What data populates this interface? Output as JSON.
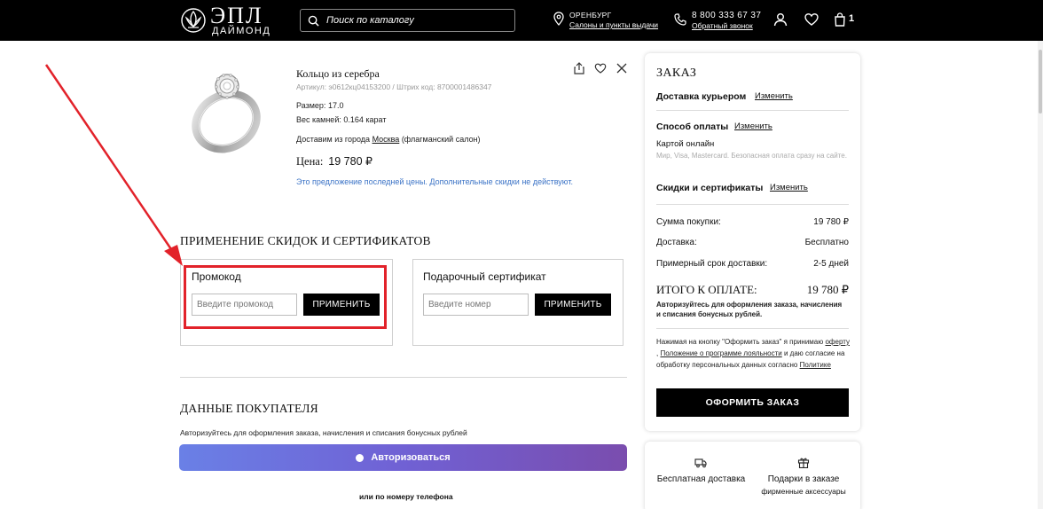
{
  "header": {
    "logo_main": "ЭПЛ",
    "logo_sub": "ДАЙМОНД",
    "search_placeholder": "Поиск по каталогу",
    "city": "ОРЕНБУРГ",
    "city_link": "Салоны и пункты выдачи",
    "phone": "8 800 333 67 37",
    "phone_link": "Обратный звонок",
    "cart_count": "1"
  },
  "product": {
    "title": "Кольцо из серебра",
    "article": "Артикул: э0612кц04153200 / Штрих код: 8700001486347",
    "size_label": "Размер:",
    "size_value": "17.0",
    "stones_label": "Вес камней:",
    "stones_value": "0.164 карат",
    "ship_prefix": "Доставим из города",
    "ship_city": "Москва",
    "ship_suffix": "(флагманский салон)",
    "price_label": "Цена:",
    "price_value": "19 780 ₽",
    "note": "Это предложение последней цены. Дополнительные скидки не действуют."
  },
  "discounts": {
    "title": "ПРИМЕНЕНИЕ СКИДОК И СЕРТИФИКАТОВ",
    "promo_title": "Промокод",
    "promo_placeholder": "Введите промокод",
    "promo_button": "ПРИМЕНИТЬ",
    "gift_title": "Подарочный сертификат",
    "gift_placeholder": "Введите номер",
    "gift_button": "ПРИМЕНИТЬ"
  },
  "buyer": {
    "title": "ДАННЫЕ ПОКУПАТЕЛЯ",
    "auth_note": "Авторизуйтесь для оформления заказа, начисления и списания бонусных рублей",
    "auth_button": "Авторизоваться",
    "or_phone": "или по номеру телефона"
  },
  "order": {
    "title": "ЗАКАЗ",
    "delivery_label": "Доставка курьером",
    "change": "Изменить",
    "payment_label": "Способ оплаты",
    "payment_value": "Картой онлайн",
    "payment_note": "Мир, Visa, Mastercard. Безопасная оплата сразу на сайте.",
    "discounts_label": "Скидки и сертификаты",
    "rows": [
      {
        "label": "Сумма покупки:",
        "value": "19 780 ₽"
      },
      {
        "label": "Доставка:",
        "value": "Бесплатно"
      },
      {
        "label": "Примерный срок доставки:",
        "value": "2-5 дней"
      }
    ],
    "total_label": "ИТОГО К ОПЛАТЕ:",
    "total_value": "19 780 ₽",
    "auth_note": "Авторизуйтесь для оформления заказа, начисления и списания бонусных рублей.",
    "legal_1": "Нажимая на кнопку \"Оформить заказ\" я принимаю",
    "legal_offer": "оферту",
    "legal_2": ",",
    "legal_loyalty": "Положение о программе лояльности",
    "legal_3": "и даю согласие на обработку персональных данных согласно",
    "legal_policy": "Политике",
    "submit_button": "ОФОРМИТЬ ЗАКАЗ"
  },
  "perks": {
    "free_delivery": "Бесплатная доставка",
    "gifts": "Подарки в заказе",
    "gifts_sub": "фирменные аксессуары"
  },
  "colors": {
    "header_bg": "#000000",
    "accent_red": "#e2222a",
    "link_blue": "#3b73c6",
    "auth_gradient_start": "#6a80e6",
    "auth_gradient_end": "#7a4dae"
  },
  "icons": [
    "lotus-logo-icon",
    "search-icon",
    "location-pin-icon",
    "phone-icon",
    "user-icon",
    "heart-icon",
    "cart-icon",
    "share-icon",
    "close-icon",
    "truck-icon",
    "gift-icon"
  ]
}
